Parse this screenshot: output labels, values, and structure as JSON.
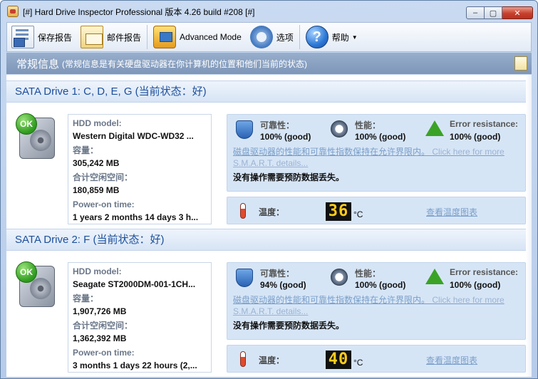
{
  "window": {
    "title": "[#] Hard Drive Inspector Professional 版本 4.26 build #208 [#]",
    "min_glyph": "–",
    "max_glyph": "▢",
    "close_glyph": "✕"
  },
  "toolbar": {
    "save_report": "保存报告",
    "email_report": "邮件报告",
    "advanced_mode": "Advanced Mode",
    "options": "选项",
    "help": "帮助",
    "help_icon_glyph": "?",
    "caret_glyph": "▼"
  },
  "section": {
    "title": "常规信息",
    "subtitle": "(常规信息是有关硬盘驱动器在你计算机的位置和他们当前的状态)"
  },
  "labels": {
    "hdd_model": "HDD model:",
    "capacity": "容量：",
    "free_space": "合计空闲空间：",
    "power_on_time": "Power-on time:",
    "reliability": "可靠性：",
    "performance": "性能：",
    "error_resistance": "Error resistance:",
    "perf_message": "磁盘驱动器的性能和可靠性指数保持在允许界限内。",
    "click_more": "Click here for more",
    "smart_details": "S.M.A.R.T. details...",
    "no_action": "没有操作需要预防数据丢失。",
    "temperature": "温度：",
    "temp_unit": "°C",
    "view_temp_chart": "查看温度图表",
    "ok_badge": "OK"
  },
  "drives": [
    {
      "title": "SATA Drive 1: C, D, E, G (当前状态：好)",
      "model": "Western Digital WDC-WD32 ...",
      "capacity": "305,242 MB",
      "free_space": "180,859 MB",
      "power_on_time": "1 years 2 months 14 days 3 h...",
      "reliability": "100% (good)",
      "performance": "100% (good)",
      "error_resistance": "100% (good)",
      "temperature": "36"
    },
    {
      "title": "SATA Drive 2: F (当前状态：好)",
      "model": "Seagate ST2000DM-001-1CH...",
      "capacity": "1,907,726 MB",
      "free_space": "1,362,392 MB",
      "power_on_time": "3 months 1 days 22 hours (2,...",
      "reliability": "94% (good)",
      "performance": "100% (good)",
      "error_resistance": "100% (good)",
      "temperature": "40"
    }
  ],
  "colors": {
    "accent": "#1c4f9a",
    "status_panel": "#d6e5f6",
    "ok_green": "#2d9b1c",
    "temp_digits": "#ffcc1a"
  }
}
